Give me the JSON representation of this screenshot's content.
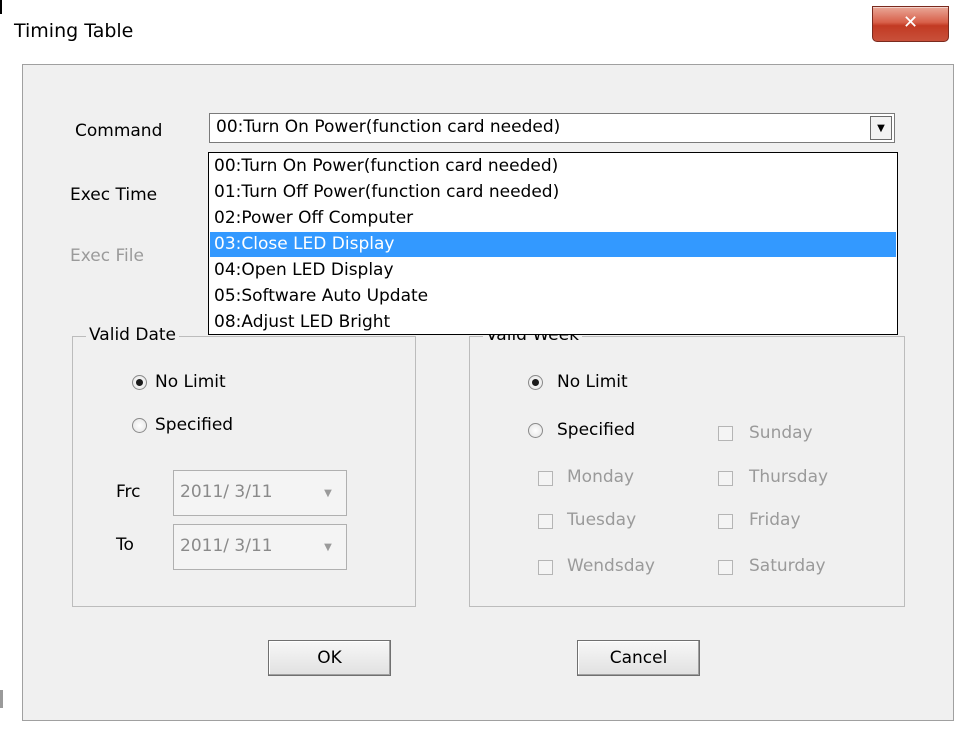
{
  "window": {
    "title": "Timing Table",
    "close_glyph": "✕"
  },
  "form": {
    "command_label": "Command",
    "exec_time_label": "Exec Time",
    "exec_file_label": "Exec File",
    "command_value": "00:Turn On Power(function card needed)"
  },
  "command_list": {
    "items": [
      "00:Turn On Power(function card needed)",
      "01:Turn Off Power(function card needed)",
      "02:Power Off Computer",
      "03:Close LED Display",
      "04:Open LED Display",
      "05:Software Auto Update",
      "08:Adjust LED Bright"
    ],
    "selected_index": 3
  },
  "valid_date": {
    "legend": "Valid Date",
    "no_limit_label": "No Limit",
    "specified_label": "Specified",
    "selected": "No Limit",
    "from_label": "Frc",
    "to_label": "To",
    "from_value": "2011/ 3/11",
    "to_value": "2011/ 3/11"
  },
  "valid_week": {
    "legend": "Valid Week",
    "no_limit_label": "No Limit",
    "specified_label": "Specified",
    "selected": "No Limit",
    "days": {
      "sunday": "Sunday",
      "monday": "Monday",
      "tuesday": "Tuesday",
      "wednesday": "Wendsday",
      "thursday": "Thursday",
      "friday": "Friday",
      "saturday": "Saturday"
    }
  },
  "buttons": {
    "ok": "OK",
    "cancel": "Cancel"
  },
  "colors": {
    "selection": "#3399ff",
    "dialog_bg": "#f0f0f0",
    "disabled_text": "#9a9a9a",
    "close_button": "#c8503a"
  }
}
